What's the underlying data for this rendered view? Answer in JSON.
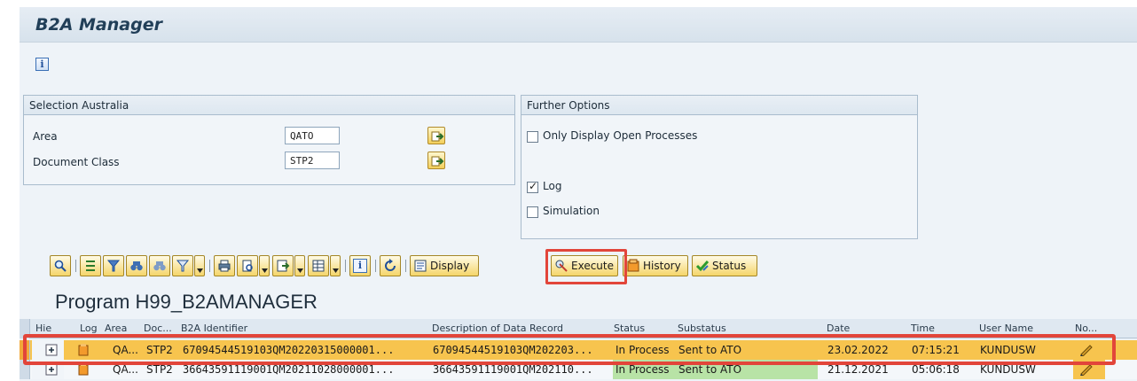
{
  "app": {
    "title": "B2A Manager"
  },
  "toolbar": {
    "info_label": "i"
  },
  "selection_group": {
    "title": "Selection Australia",
    "fields": [
      {
        "label": "Area",
        "value": "QATO"
      },
      {
        "label": "Document Class",
        "value": "STP2"
      }
    ]
  },
  "options_group": {
    "title": "Further Options",
    "only_open": {
      "label": "Only Display Open Processes",
      "checked": false
    },
    "log": {
      "label": "Log",
      "checked": true
    },
    "simulation": {
      "label": "Simulation",
      "checked": false
    }
  },
  "alv_toolbar": {
    "display_label": "Display",
    "execute_label": "Execute",
    "history_label": "History",
    "status_label": "Status",
    "info_label": "i"
  },
  "program": {
    "title": "Program H99_B2AMANAGER"
  },
  "grid": {
    "columns": [
      "Hie",
      "Log",
      "Area",
      "Doc...",
      "B2A Identifier",
      "Description of Data Record",
      "Status",
      "Substatus",
      "Date",
      "Time",
      "User Name",
      "No..."
    ],
    "rows": [
      {
        "area": "QA...",
        "doc": "STP2",
        "identifier": "67094544519103QM20220315000001...",
        "description": "67094544519103QM202203...",
        "status": "In Process",
        "substatus": "Sent to ATO",
        "date": "23.02.2022",
        "time": "07:15:21",
        "user": "KUNDUSW"
      },
      {
        "area": "QA...",
        "doc": "STP2",
        "identifier": "36643591119001QM20211028000001...",
        "description": "36643591119001QM202110...",
        "status": "In Process",
        "substatus": "Sent to ATO",
        "date": "21.12.2021",
        "time": "05:06:18",
        "user": "KUNDUSW"
      }
    ]
  },
  "colors": {
    "highlight": "#e2453a",
    "row_selected": "#f7c44e",
    "status_green": "#b8e3a6",
    "header_bg": "#dfe8f1"
  }
}
